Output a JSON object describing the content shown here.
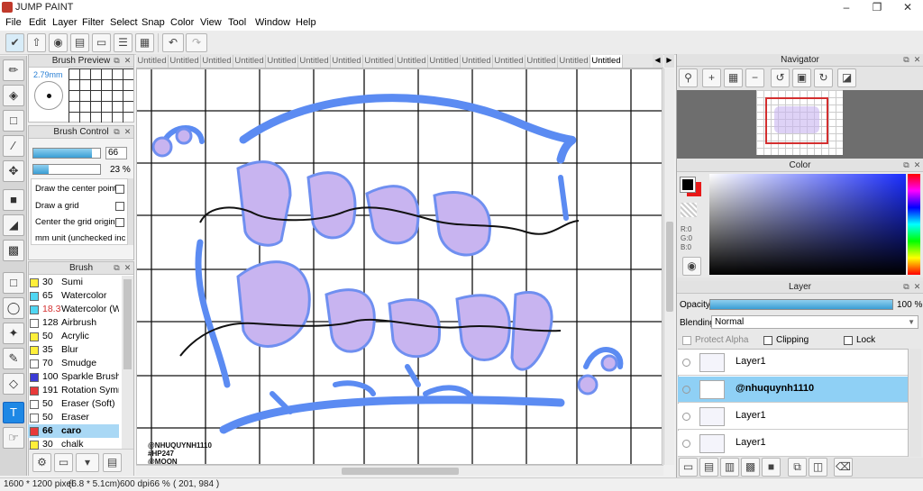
{
  "app": {
    "title": "JUMP PAINT"
  },
  "menu": [
    "File",
    "Edit",
    "Layer",
    "Filter",
    "Select",
    "Snap",
    "Color",
    "View",
    "Tool",
    "Window",
    "Help"
  ],
  "brush_preview": {
    "title": "Brush Preview",
    "size_label": "2.79mm"
  },
  "brush_control": {
    "title": "Brush Control",
    "size_value": "66",
    "size_fraction": 0.88,
    "opacity_value": "23 %",
    "opacity_fraction": 0.23,
    "options": [
      "Draw the center point",
      "Draw a grid",
      "Center the grid origin",
      "mm unit (unchecked inch"
    ]
  },
  "brush": {
    "title": "Brush",
    "items": [
      {
        "size": "30",
        "name": "Sumi",
        "color": "#ffef3a"
      },
      {
        "size": "65",
        "name": "Watercolor",
        "color": "#4fd6f2"
      },
      {
        "size": "18.3",
        "name": "Watercolor (We",
        "color": "#4fd6f2"
      },
      {
        "size": "128",
        "name": "Airbrush",
        "color": "#ffffff"
      },
      {
        "size": "50",
        "name": "Acrylic",
        "color": "#ffef3a"
      },
      {
        "size": "35",
        "name": "Blur",
        "color": "#ffef3a"
      },
      {
        "size": "70",
        "name": "Smudge",
        "color": "#ffffff"
      },
      {
        "size": "100",
        "name": "Sparkle Brush",
        "color": "#3b3bd6"
      },
      {
        "size": "191",
        "name": "Rotation Symme",
        "color": "#e83a3a"
      },
      {
        "size": "50",
        "name": "Eraser (Soft)",
        "color": "#ffffff"
      },
      {
        "size": "50",
        "name": "Eraser",
        "color": "#ffffff"
      },
      {
        "size": "66",
        "name": "caro",
        "color": "#e83a3a"
      },
      {
        "size": "30",
        "name": "chalk",
        "color": "#ffef3a"
      }
    ]
  },
  "tabs": [
    "Untitled",
    "Untitled",
    "Untitled",
    "Untitled",
    "Untitled",
    "Untitled",
    "Untitled",
    "Untitled",
    "Untitled",
    "Untitled",
    "Untitled",
    "Untitled",
    "Untitled",
    "Untitled",
    "Untitled"
  ],
  "canvas_art": {
    "watermark": [
      "@NHUQUYNH1110",
      "#HP247",
      "@MOON"
    ]
  },
  "navigator": {
    "title": "Navigator"
  },
  "color": {
    "title": "Color",
    "r": "R:0",
    "g": "G:0",
    "b": "B:0"
  },
  "layer": {
    "title": "Layer",
    "opacity_label": "Opacity",
    "opacity_value": "100 %",
    "blending_label": "Blending",
    "blending_value": "Normal",
    "protect_alpha": "Protect Alpha",
    "clipping": "Clipping",
    "lock": "Lock",
    "rows": [
      {
        "name": "Layer1",
        "selected": false
      },
      {
        "name": "@nhuquynh1110",
        "selected": true
      },
      {
        "name": "Layer1",
        "selected": false
      },
      {
        "name": "Layer1",
        "selected": false
      }
    ]
  },
  "status": {
    "pixels": "1600 * 1200 pixel",
    "cm": "(6.8 * 5.1cm)",
    "dpi": "600 dpi",
    "zoom": "66 %",
    "coords": "( 201, 984 )"
  }
}
